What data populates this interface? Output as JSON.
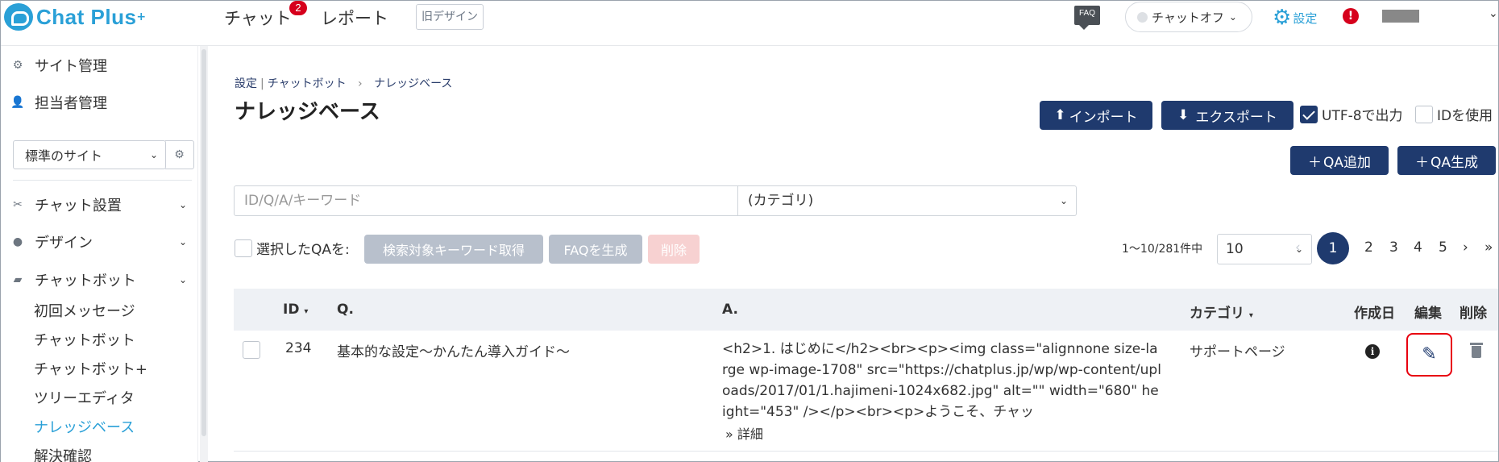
{
  "header": {
    "logo_text": "Chat Plus",
    "logo_plus": "+",
    "nav_chat": "チャット",
    "nav_chat_badge": "2",
    "nav_report": "レポート",
    "old_design": "旧デザイン",
    "faq_label": "FAQ",
    "chat_status": "チャットオフ",
    "settings": "設定",
    "alert": "!"
  },
  "sidebar": {
    "site_mgmt": "サイト管理",
    "staff_mgmt": "担当者管理",
    "site_select": "標準のサイト",
    "chat_setup": "チャット設置",
    "design": "デザイン",
    "chatbot": "チャットボット",
    "sub_items": [
      "初回メッセージ",
      "チャットボット",
      "チャットボット+",
      "ツリーエディタ",
      "ナレッジベース",
      "解決確認"
    ]
  },
  "breadcrumb": {
    "settings": "設定",
    "chatbot": "チャットボット",
    "arrow": "›",
    "current": "ナレッジベース"
  },
  "page_title": "ナレッジベース",
  "toolbar": {
    "import": "インポート",
    "export": "エクスポート",
    "utf8": "UTF-8で出力",
    "use_id": "IDを使用",
    "add_qa": "QA追加",
    "gen_qa": "QA生成"
  },
  "search": {
    "placeholder": "ID/Q/A/キーワード",
    "category": "(カテゴリ)"
  },
  "bulk": {
    "label": "選択したQAを:",
    "keyword": "検索対象キーワード取得",
    "faq": "FAQを生成",
    "delete": "削除"
  },
  "pager": {
    "info": "1〜10/281件中",
    "per_page": "10",
    "prev": "‹",
    "pages": [
      "1",
      "2",
      "3",
      "4",
      "5"
    ],
    "next": "›",
    "last": "»"
  },
  "table": {
    "headers": {
      "id": "ID",
      "q": "Q.",
      "a": "A.",
      "category": "カテゴリ",
      "created": "作成日",
      "edit": "編集",
      "delete": "削除"
    },
    "rows": [
      {
        "id": "234",
        "q": "基本的な設定〜かんたん導入ガイド〜",
        "a": "<h2>1. はじめに</h2><br><p><img class=\"alignnone size-large wp-image-1708\" src=\"https://chatplus.jp/wp/wp-content/uploads/2017/01/1.hajimeni-1024x682.jpg\" alt=\"\" width=\"680\" height=\"453\" /></p><br><p>ようこそ、チャッ",
        "detail": "詳細",
        "category": "サポートページ"
      }
    ]
  }
}
